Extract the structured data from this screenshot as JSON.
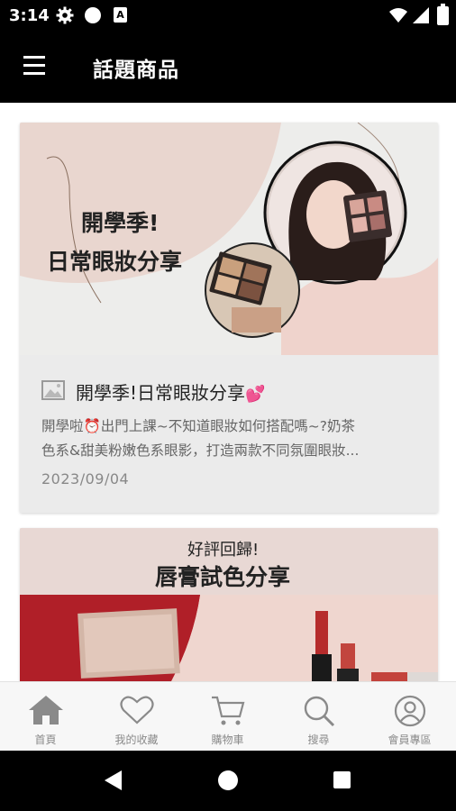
{
  "status_bar": {
    "time": "3:14",
    "icons": [
      "gear-icon",
      "circle-icon",
      "a-icon",
      "wifi-icon",
      "signal-icon",
      "battery-icon"
    ]
  },
  "app_bar": {
    "title": "話題商品",
    "menu_icon": "hamburger-menu-icon"
  },
  "cards": [
    {
      "banner_line1": "開學季!",
      "banner_line2": "日常眼妝分享",
      "title": "開學季!日常眼妝分享",
      "title_emoji": "💕",
      "description_line1": "開學啦⏰出門上課~不知道眼妝如何搭配嗎~?奶茶",
      "description_line2": "色系&甜美粉嫩色系眼影，打造兩款不同氛圍眼妝...",
      "date": "2023/09/04"
    },
    {
      "banner_line1": "好評回歸!",
      "banner_line2": "唇膏試色分享"
    }
  ],
  "bottom_nav": [
    {
      "label": "首頁",
      "icon": "home-icon"
    },
    {
      "label": "我的收藏",
      "icon": "heart-icon"
    },
    {
      "label": "購物車",
      "icon": "cart-icon"
    },
    {
      "label": "搜尋",
      "icon": "search-icon"
    },
    {
      "label": "會員專區",
      "icon": "user-icon"
    }
  ],
  "colors": {
    "app_bar": "#000000",
    "card_bg": "#ebebeb",
    "nav_bg": "#f7f7f7",
    "nav_icon": "#8a8a8a",
    "lipstick_red": "#b52026"
  }
}
